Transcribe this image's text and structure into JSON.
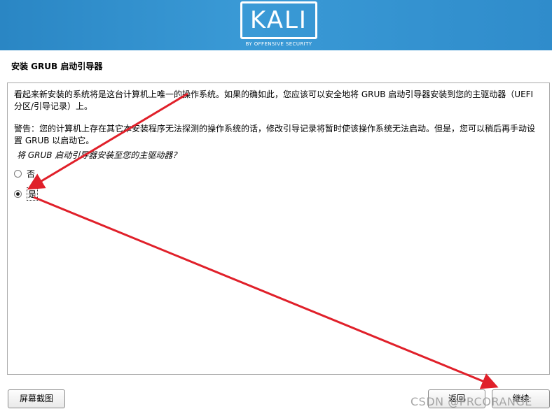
{
  "header": {
    "logo_text": "KALI",
    "logo_subtitle": "BY OFFENSIVE SECURITY"
  },
  "page": {
    "title": "安装 GRUB 启动引导器",
    "paragraph1": "看起来新安装的系统将是这台计算机上唯一的操作系统。如果的确如此，您应该可以安全地将 GRUB 启动引导器安装到您的主驱动器（UEFI 分区/引导记录）上。",
    "paragraph2": "警告：您的计算机上存在其它本安装程序无法探测的操作系统的话，修改引导记录将暂时使该操作系统无法启动。但是，您可以稍后再手动设置 GRUB 以启动它。",
    "question": "将 GRUB 启动引导器安装至您的主驱动器？",
    "options": [
      {
        "label": "否",
        "selected": false
      },
      {
        "label": "是",
        "selected": true
      }
    ]
  },
  "buttons": {
    "screenshot": "屏幕截图",
    "back": "返回",
    "continue": "继续"
  },
  "watermark": "CSDN @PRCORANGE",
  "colors": {
    "banner": "#2a86c4",
    "annotation_arrow": "#e0202a"
  }
}
